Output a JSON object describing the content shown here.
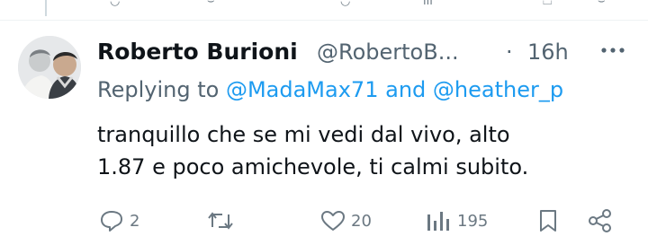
{
  "tweet": {
    "author_name": "Roberto Burioni",
    "author_handle": "@RobertoB...",
    "separator": "·",
    "time": "16h",
    "replying_prefix": "Replying to",
    "replying_mention_1": "@MadaMax71",
    "replying_and": "and",
    "replying_mention_2": "@heather_p",
    "text_line_1": "tranquillo che se mi vedi dal vivo, alto",
    "text_line_2": "1.87 e poco amichevole, ti calmi subito."
  },
  "actions": {
    "reply_count": "2",
    "retweet_count": "",
    "like_count": "20",
    "views_count": "195"
  },
  "colors": {
    "text_primary": "#0f1419",
    "text_secondary": "#536471",
    "link": "#1d9bf0",
    "icon": "#6b7882"
  },
  "icons": [
    "reply-icon",
    "retweet-icon",
    "like-icon",
    "views-icon",
    "bookmark-icon",
    "share-icon",
    "more-icon"
  ]
}
